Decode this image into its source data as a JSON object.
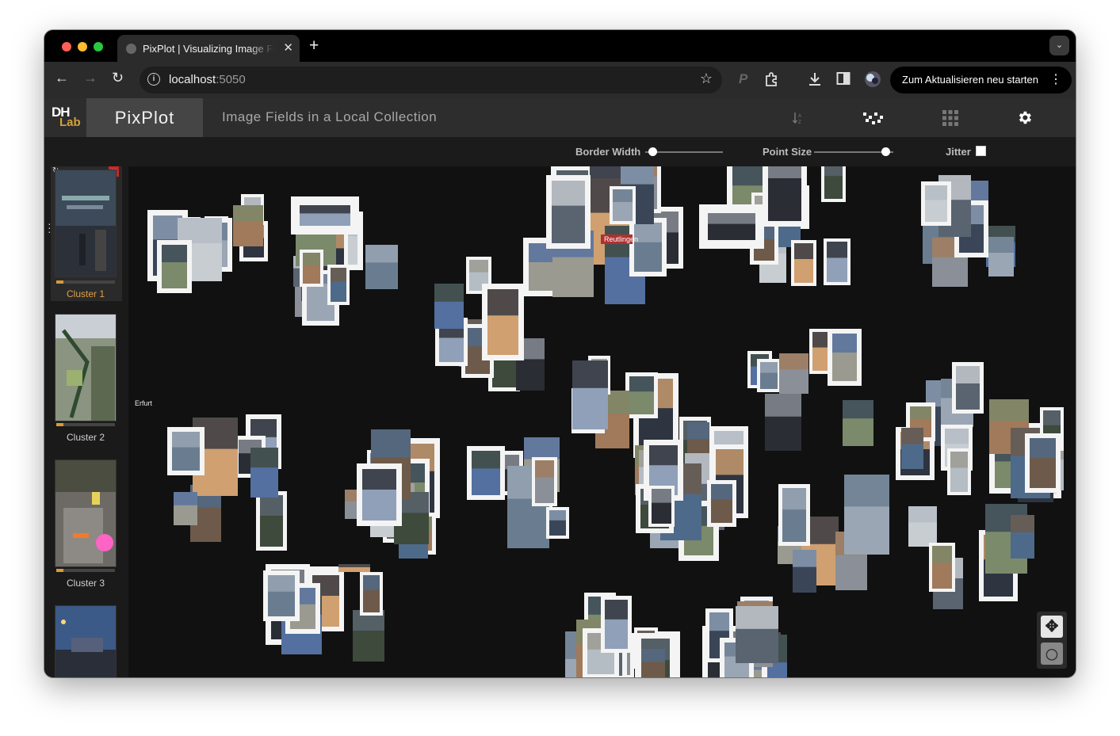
{
  "browser": {
    "tab_title": "PixPlot | Visualizing Image Fields in a Local Collection",
    "tab_close": "✕",
    "new_tab": "+",
    "tab_menu": "⌄",
    "url_host": "localhost",
    "url_port": ":5050",
    "relaunch_label": "Zum Aktualisieren neu starten"
  },
  "app": {
    "logo_top": "DH",
    "logo_bottom": "Lab",
    "brand": "PixPlot",
    "subtitle": "Image Fields in a Local Collection",
    "controls": {
      "border_width_label": "Border Width",
      "border_width_value": 0.1,
      "point_size_label": "Point Size",
      "point_size_value": 0.9,
      "jitter_label": "Jitter",
      "jitter_checked": false
    }
  },
  "sidebar": {
    "clusters": [
      {
        "label": "Cluster 1",
        "selected": true
      },
      {
        "label": "Cluster 2",
        "selected": false
      },
      {
        "label": "Cluster 3",
        "selected": false
      }
    ],
    "close_icon": "×"
  },
  "colors": {
    "accent": "#d89a3a",
    "canvas_bg": "#111111",
    "header_bg": "#2d2d2d"
  },
  "canvas": {
    "thumb_texts": [
      "Erfurt",
      "Reutlingen"
    ]
  }
}
